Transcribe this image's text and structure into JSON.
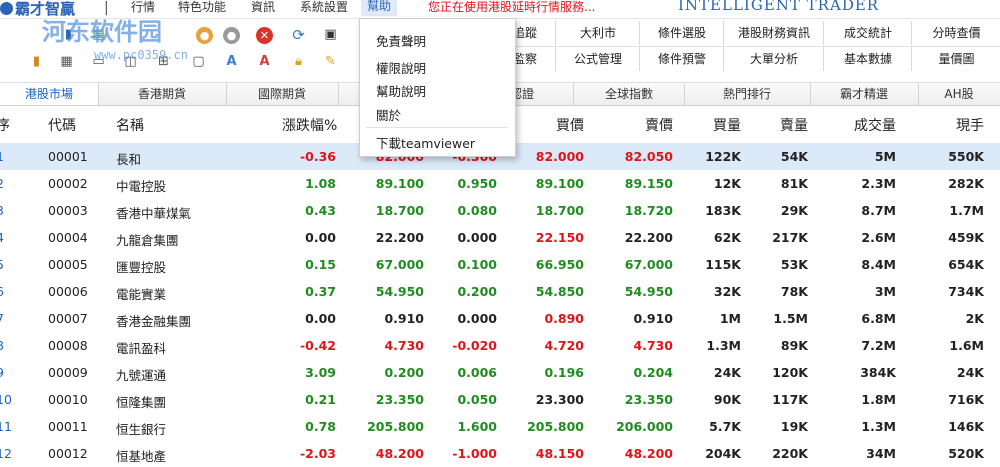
{
  "app": {
    "logo_text": "霸才智贏",
    "brand_en": "INTELLIGENT TRADER",
    "marquee": "您正在使用港股延時行情服務..."
  },
  "watermark": {
    "text": "河东软件园",
    "url": "www.pc0359.cn"
  },
  "menu": {
    "items": [
      "行情",
      "特色功能",
      "資訊",
      "系統設置",
      "幫助"
    ],
    "active_index": 4
  },
  "dropdown": {
    "items": [
      "免責聲明",
      "權限說明",
      "幫助說明",
      "關於",
      "下載teamviewer"
    ]
  },
  "toolbar_icons": [
    "record-icon",
    "stock-icon",
    "chart-icon",
    "red-circle-icon",
    "gray-circle-icon",
    "stop-icon",
    "refresh-icon",
    "save-icon",
    "lock-icon",
    "pencil-icon",
    "grid-icon",
    "window-icon",
    "print-icon",
    "alert-icon"
  ],
  "function_grid": {
    "row1": [
      "追蹤",
      "大利市",
      "條件選股",
      "港股財務資訊",
      "成交統計",
      "分時查價"
    ],
    "row2": [
      "監察",
      "公式管理",
      "條件預警",
      "大單分析",
      "基本數據",
      "量價圖"
    ]
  },
  "tabs": {
    "items": [
      "港股市場",
      "香港期貨",
      "國際期貨",
      "",
      "認證",
      "全球指數",
      "熱門排行",
      "霸才精選",
      "AH股"
    ],
    "active_index": 0
  },
  "table": {
    "headers": [
      "序",
      "代碼",
      "名稱",
      "漲跌幅%",
      "",
      "",
      "買價",
      "賣價",
      "買量",
      "賣量",
      "成交量",
      "現手"
    ],
    "rows": [
      {
        "idx": "1",
        "code": "00001",
        "name": "長和",
        "pct": "-0.36",
        "price": "82.000",
        "chg": "-0.300",
        "bid": "82.000",
        "ask": "82.050",
        "bidv": "122K",
        "askv": "54K",
        "vol": "5M",
        "last": "550K",
        "dir": "down"
      },
      {
        "idx": "2",
        "code": "00002",
        "name": "中電控股",
        "pct": "1.08",
        "price": "89.100",
        "chg": "0.950",
        "bid": "89.100",
        "ask": "89.150",
        "bidv": "12K",
        "askv": "81K",
        "vol": "2.3M",
        "last": "282K",
        "dir": "up"
      },
      {
        "idx": "3",
        "code": "00003",
        "name": "香港中華煤氣",
        "pct": "0.43",
        "price": "18.700",
        "chg": "0.080",
        "bid": "18.700",
        "ask": "18.720",
        "bidv": "183K",
        "askv": "29K",
        "vol": "8.7M",
        "last": "1.7M",
        "dir": "up"
      },
      {
        "idx": "4",
        "code": "00004",
        "name": "九龍倉集團",
        "pct": "0.00",
        "price": "22.200",
        "chg": "0.000",
        "bid": "22.150",
        "ask": "22.200",
        "bidv": "62K",
        "askv": "217K",
        "vol": "2.6M",
        "last": "459K",
        "dir": "flat",
        "bid_dir": "down"
      },
      {
        "idx": "5",
        "code": "00005",
        "name": "匯豐控股",
        "pct": "0.15",
        "price": "67.000",
        "chg": "0.100",
        "bid": "66.950",
        "ask": "67.000",
        "bidv": "115K",
        "askv": "53K",
        "vol": "8.4M",
        "last": "654K",
        "dir": "up"
      },
      {
        "idx": "6",
        "code": "00006",
        "name": "電能實業",
        "pct": "0.37",
        "price": "54.950",
        "chg": "0.200",
        "bid": "54.850",
        "ask": "54.950",
        "bidv": "32K",
        "askv": "78K",
        "vol": "3M",
        "last": "734K",
        "dir": "up"
      },
      {
        "idx": "7",
        "code": "00007",
        "name": "香港金融集團",
        "pct": "0.00",
        "price": "0.910",
        "chg": "0.000",
        "bid": "0.890",
        "ask": "0.910",
        "bidv": "1M",
        "askv": "1.5M",
        "vol": "6.8M",
        "last": "2K",
        "dir": "flat",
        "bid_dir": "down"
      },
      {
        "idx": "8",
        "code": "00008",
        "name": "電訊盈科",
        "pct": "-0.42",
        "price": "4.730",
        "chg": "-0.020",
        "bid": "4.720",
        "ask": "4.730",
        "bidv": "1.3M",
        "askv": "89K",
        "vol": "7.2M",
        "last": "1.6M",
        "dir": "down"
      },
      {
        "idx": "9",
        "code": "00009",
        "name": "九號運通",
        "pct": "3.09",
        "price": "0.200",
        "chg": "0.006",
        "bid": "0.196",
        "ask": "0.204",
        "bidv": "24K",
        "askv": "120K",
        "vol": "384K",
        "last": "24K",
        "dir": "up"
      },
      {
        "idx": "10",
        "code": "00010",
        "name": "恒隆集團",
        "pct": "0.21",
        "price": "23.350",
        "chg": "0.050",
        "bid": "23.300",
        "ask": "23.350",
        "bidv": "90K",
        "askv": "117K",
        "vol": "1.8M",
        "last": "716K",
        "dir": "up",
        "bid_dir": "flat"
      },
      {
        "idx": "11",
        "code": "00011",
        "name": "恒生銀行",
        "pct": "0.78",
        "price": "205.800",
        "chg": "1.600",
        "bid": "205.800",
        "ask": "206.000",
        "bidv": "5.7K",
        "askv": "19K",
        "vol": "1.3M",
        "last": "146K",
        "dir": "up"
      },
      {
        "idx": "12",
        "code": "00012",
        "name": "恒基地產",
        "pct": "-2.03",
        "price": "48.200",
        "chg": "-1.000",
        "bid": "48.150",
        "ask": "48.200",
        "bidv": "204K",
        "askv": "220K",
        "vol": "34M",
        "last": "520K",
        "dir": "down"
      }
    ],
    "selected_index": 0
  },
  "colors": {
    "up": "#1f8c1f",
    "down": "#e01418",
    "accent": "#1e62c6",
    "selected_row": "#dbe9f8"
  }
}
